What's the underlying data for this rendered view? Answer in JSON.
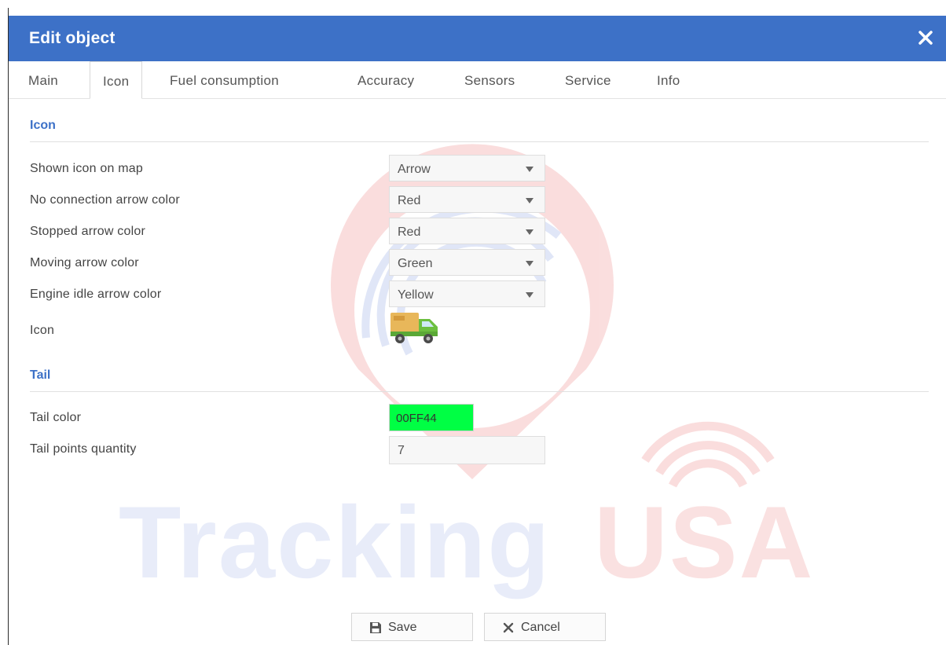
{
  "dialog": {
    "title": "Edit object"
  },
  "tabs": [
    {
      "label": "Main"
    },
    {
      "label": "Icon"
    },
    {
      "label": "Fuel consumption"
    },
    {
      "label": "Accuracy"
    },
    {
      "label": "Sensors"
    },
    {
      "label": "Service"
    },
    {
      "label": "Info"
    }
  ],
  "active_tab": "Icon",
  "icon_section": {
    "title": "Icon",
    "fields": [
      {
        "label": "Shown icon on map",
        "value": "Arrow"
      },
      {
        "label": "No connection arrow color",
        "value": "Red"
      },
      {
        "label": "Stopped arrow color",
        "value": "Red"
      },
      {
        "label": "Moving arrow color",
        "value": "Green"
      },
      {
        "label": "Engine idle arrow color",
        "value": "Yellow"
      }
    ],
    "icon_label": "Icon",
    "icon_name": "delivery-truck-icon"
  },
  "tail_section": {
    "title": "Tail",
    "color_label": "Tail color",
    "color_value": "00FF44",
    "color_hex": "#00ff44",
    "points_label": "Tail points quantity",
    "points_value": "7"
  },
  "buttons": {
    "save": "Save",
    "cancel": "Cancel"
  },
  "watermark": {
    "left": "Tracking",
    "right": "USA"
  },
  "colors": {
    "accent": "#3d71c7",
    "tail": "#00ff44"
  }
}
